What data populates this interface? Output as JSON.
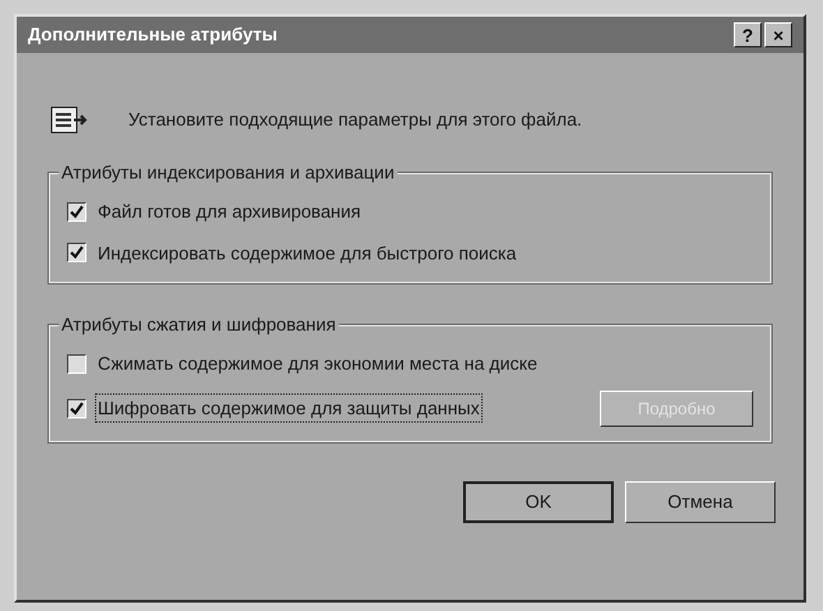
{
  "window": {
    "title": "Дополнительные атрибуты",
    "title_buttons": [
      "?",
      "×"
    ]
  },
  "intro": "Установите подходящие параметры для этого файла.",
  "groups": [
    {
      "title": "Атрибуты индексирования и архивации",
      "options": [
        {
          "label": "Файл готов для архивирования",
          "checked": true,
          "focused": false
        },
        {
          "label": "Индексировать содержимое для быстрого поиска",
          "checked": true,
          "focused": false
        }
      ]
    },
    {
      "title": "Атрибуты сжатия и шифрования",
      "options": [
        {
          "label": "Сжимать содержимое для экономии места на диске",
          "checked": false,
          "focused": false
        },
        {
          "label": "Шифровать содержимое для защиты данных",
          "checked": true,
          "focused": true
        }
      ],
      "button": {
        "label": "Подробно",
        "disabled": true
      }
    }
  ],
  "buttons": [
    {
      "label": "OK",
      "default": true
    },
    {
      "label": "Отмена",
      "default": false
    }
  ]
}
